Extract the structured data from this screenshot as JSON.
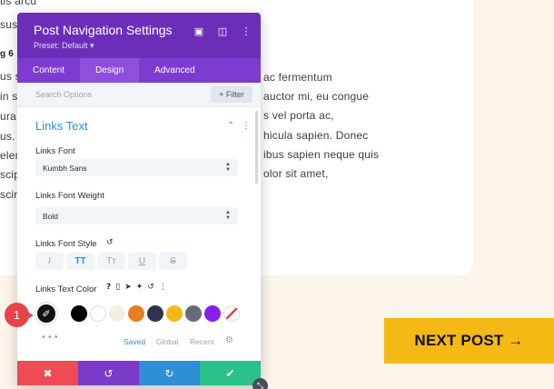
{
  "background": {
    "lines": [
      "tis arcu",
      "sus l",
      "g 6",
      "us si",
      "in so",
      "ura",
      "us.",
      "elen",
      "scip",
      "scin"
    ],
    "right_lines": [
      "ac fermentum",
      "auctor mi, eu congue",
      "s vel porta ac,",
      "hicula sapien. Donec",
      "ibus sapien neque quis",
      "olor sit amet,"
    ],
    "next_post": "NEXT POST →"
  },
  "modal": {
    "title": "Post Navigation Settings",
    "preset": "Preset: Default ▾",
    "tabs": [
      "Content",
      "Design",
      "Advanced"
    ],
    "active_tab": "Design",
    "search_placeholder": "Search Options",
    "filter_label": "+ Filter",
    "section_title": "Links Text",
    "font_label": "Links Font",
    "font_value": "Kumbh Sans",
    "weight_label": "Links Font Weight",
    "weight_value": "Bold",
    "style_label": "Links Font Style",
    "style_buttons": [
      "I",
      "TT",
      "Tᴛ",
      "U",
      "S"
    ],
    "color_label": "Links Text Color",
    "color_swatches": [
      "#000000",
      "#ffffff",
      "#f4ede2",
      "#e67e22",
      "#2f3350",
      "#f5b916",
      "#6a6a78",
      "#8a1cf0"
    ],
    "saved_tabs": [
      "Saved",
      "Global",
      "Recent"
    ],
    "footer_colors": [
      "#ef4b54",
      "#7b3bc9",
      "#2e8ed6",
      "#2cc08b"
    ],
    "accent": "#2e8ed6",
    "header_color": "#6c2eb9"
  },
  "annotation": {
    "badge": "1"
  }
}
